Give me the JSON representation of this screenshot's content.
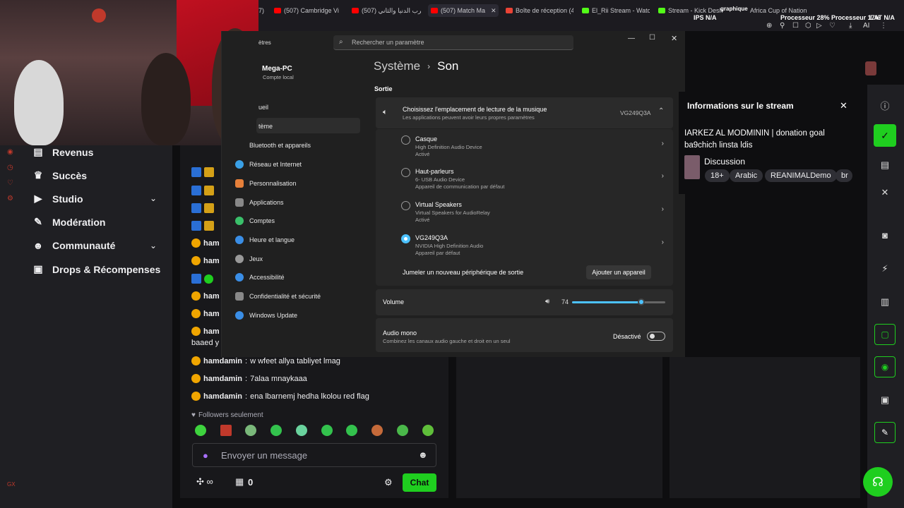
{
  "browser": {
    "tabs": [
      {
        "label": "7)",
        "color": "#ff0000"
      },
      {
        "label": "(507) Cambridge Vi",
        "color": "#ff0000"
      },
      {
        "label": "حرب الدنيا والثاني (507)",
        "color": "#ff0000"
      },
      {
        "label": "(507) Match Ma",
        "color": "#ff0000"
      },
      {
        "label": "Boîte de réception (4",
        "color": "#ea4335"
      },
      {
        "label": "El_Rii Stream - Watc",
        "color": "#53fc18"
      },
      {
        "label": "Stream - Kick Desh",
        "color": "#53fc18"
      },
      {
        "label": "Africa Cup of Nation",
        "color": "#888888"
      }
    ],
    "sys_stats": {
      "line1": "Processeur 28% Processeur 17%",
      "label_gpu": "graphique",
      "fps": "IPS N/A",
      "lat": "LAT N/A",
      "ai": "AI"
    }
  },
  "left_nav": {
    "items": [
      {
        "label": "Revenus",
        "icon": "bar-chart-icon"
      },
      {
        "label": "Succès",
        "icon": "trophy-icon"
      },
      {
        "label": "Studio",
        "icon": "video-icon",
        "expand": true
      },
      {
        "label": "Modération",
        "icon": "wrench-icon"
      },
      {
        "label": "Communauté",
        "icon": "people-icon",
        "expand": true
      },
      {
        "label": "Drops & Récompenses",
        "icon": "gift-icon"
      }
    ]
  },
  "chat": {
    "lines": [
      {
        "user": "hamdamin",
        "text": "w wfeet allya tabliyet lmag"
      },
      {
        "user": "hamdamin",
        "text": "7alaa mnaykaaa"
      },
      {
        "user": "hamdamin",
        "text": "ena lbarnemj hedha lkolou red flag"
      }
    ],
    "partial_users": [
      "ham",
      "ham",
      "ham",
      "ham",
      "ham"
    ],
    "partial_text": "baaed y",
    "followers_only": "Followers seulement",
    "placeholder": "Envoyer un message",
    "count": "0",
    "chat_button": "Chat"
  },
  "settings": {
    "window_title": "ètres",
    "search_placeholder": "Rechercher un paramètre",
    "user": {
      "name": "Mega-PC",
      "account": "Compte local"
    },
    "breadcrumb": {
      "parent": "Système",
      "current": "Son"
    },
    "nav": [
      {
        "label": "ueil",
        "color": "#888"
      },
      {
        "label": "tème",
        "color": "#3a8ee6"
      },
      {
        "label": "Bluetooth et appareils",
        "color": "#3a8ee6"
      },
      {
        "label": "Réseau et Internet",
        "color": "#3aa0e6"
      },
      {
        "label": "Personnalisation",
        "color": "#e6803a"
      },
      {
        "label": "Applications",
        "color": "#888"
      },
      {
        "label": "Comptes",
        "color": "#3ac06a"
      },
      {
        "label": "Heure et langue",
        "color": "#3a8ee6"
      },
      {
        "label": "Jeux",
        "color": "#999"
      },
      {
        "label": "Accessibilité",
        "color": "#3a8ee6"
      },
      {
        "label": "Confidentialité et sécurité",
        "color": "#888"
      },
      {
        "label": "Windows Update",
        "color": "#3a8ee6"
      }
    ],
    "section_output": "Sortie",
    "output_header": {
      "title": "Choisissez l'emplacement de lecture de la musique",
      "subtitle": "Les applications peuvent avoir leurs propres paramètres",
      "selected": "VG249Q3A"
    },
    "devices": [
      {
        "name": "Casque",
        "sub1": "High Definition Audio Device",
        "sub2": "Activé",
        "selected": false
      },
      {
        "name": "Haut-parleurs",
        "sub1": "6- USB Audio Device",
        "sub2": "Appareil de communication par défaut",
        "selected": false
      },
      {
        "name": "Virtual Speakers",
        "sub1": "Virtual Speakers for AudioRelay",
        "sub2": "Activé",
        "selected": false
      },
      {
        "name": "VG249Q3A",
        "sub1": "NVIDIA High Definition Audio",
        "sub2": "Appareil par défaut",
        "selected": true
      }
    ],
    "pair_label": "Jumeler un nouveau périphérique de sortie",
    "add_device": "Ajouter un appareil",
    "volume_label": "Volume",
    "volume_value": "74",
    "volume_level": 0.74,
    "mono_title": "Audio mono",
    "mono_sub": "Combinez les canaux audio gauche et droit en un seul",
    "mono_state": "Désactivé"
  },
  "stream_info": {
    "title": "Informations sur le stream",
    "stream_title": "IARKEZ AL MODMININ | donation goal ba9chich linsta ldis",
    "category": "Discussion",
    "tags": [
      "18+",
      "Arabic",
      "REANIMALDemo",
      "br"
    ]
  },
  "colors": {
    "accent_green": "#1fce1f",
    "win_accent": "#4cc2ff"
  }
}
